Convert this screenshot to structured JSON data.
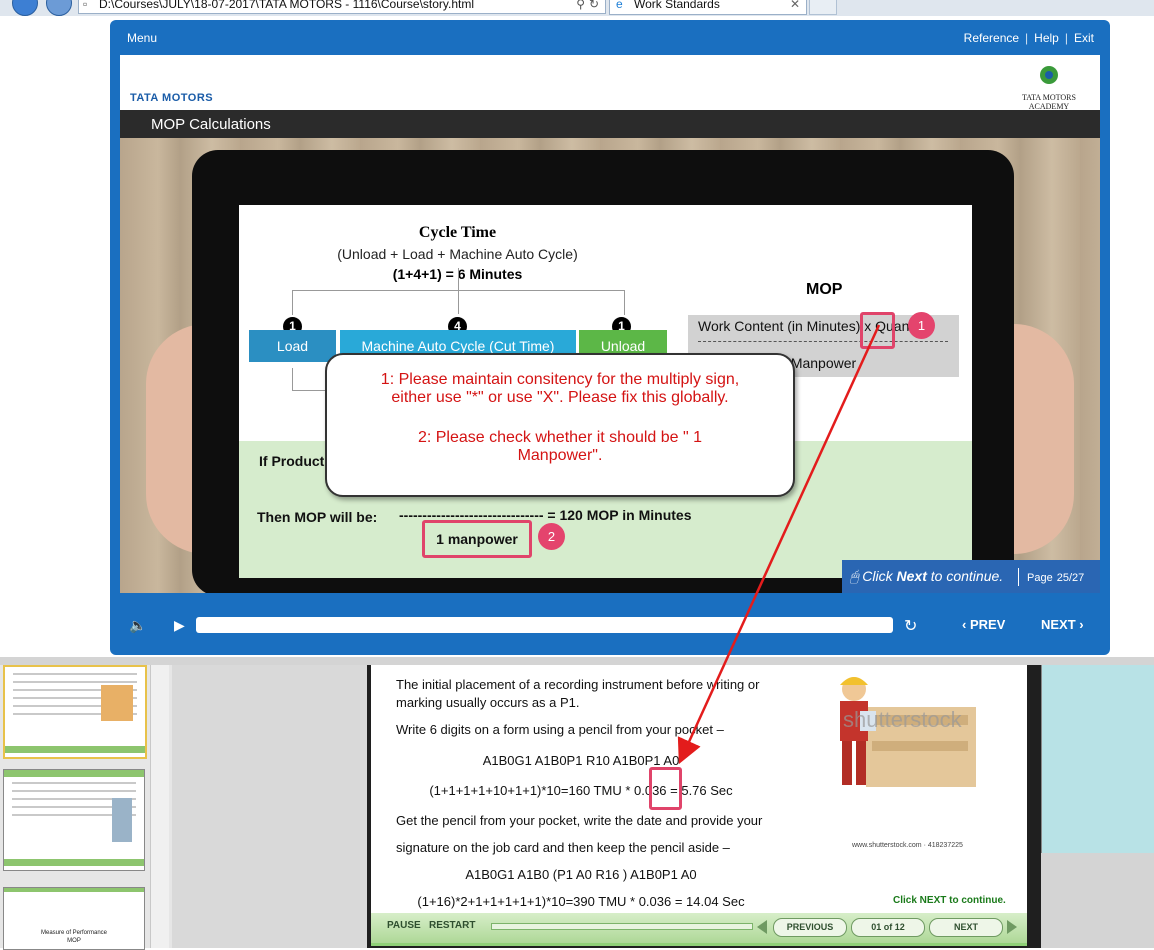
{
  "browser": {
    "address": "D:\\Courses\\JULY\\18-07-2017\\TATA MOTORS - 1116\\Course\\story.html",
    "tab_title": "Work Standards"
  },
  "player": {
    "menu_label": "Menu",
    "links": [
      "Reference",
      "Help",
      "Exit"
    ],
    "brand_left": "TATA MOTORS",
    "brand_right": "TATA MOTORS ACADEMY",
    "slide_title": "MOP Calculations",
    "click_next": {
      "prefix": "Click ",
      "bold": "Next",
      "suffix": " to continue."
    },
    "page_label": "Page",
    "page_value": "25/27",
    "prev_label": "PREV",
    "next_label": "NEXT"
  },
  "slide": {
    "cycle_title": "Cycle Time",
    "cycle_sub": "(Unload + Load + Machine Auto Cycle)",
    "cycle_calc": "(1+4+1) = 6 Minutes",
    "boxes": [
      {
        "label": "Load",
        "badge": "1"
      },
      {
        "label": "Machine Auto Cycle (Cut Time)",
        "badge": "4"
      },
      {
        "label": "Unload",
        "badge": "1"
      }
    ],
    "mop_title": "MOP",
    "mop_numerator": "Work Content (in Minutes) x Quantity",
    "mop_denominator": "Manpower",
    "if_text": "If Product",
    "then_text": "Then MOP will be:",
    "then_eq": "------------------------------- = 120 MOP in Minutes",
    "manpower_box": "1 manpower",
    "marker_1": "1",
    "marker_2": "2"
  },
  "callout": {
    "line1": "1: Please maintain consitency for the multiply sign,",
    "line2": "either use \"*\" or use \"X\". Please fix this globally.",
    "line3": "2: Please check whether it should be \" 1",
    "line4": "Manpower\"."
  },
  "lower_course": {
    "p1a": "The initial placement of a recording instrument before writing or",
    "p1b": "marking usually occurs as a P1.",
    "p2": "Write 6 digits on a form using a pencil from your pocket –",
    "code1": "A1B0G1  A1B0P1 R10 A1B0P1 A0",
    "calc1": "(1+1+1+1+10+1+1)*10=160  TMU * 0.036 = 5.76 Sec",
    "p3a": "Get the pencil from your pocket, write the date and provide your",
    "p3b": "signature on the job card and then keep the pencil aside –",
    "code2": "A1B0G1  A1B0  (P1  A0  R16 ) A1B0P1  A0",
    "calc2": "(1+16)*2+1+1+1+1+1)*10=390  TMU * 0.036 = 14.04 Sec",
    "watermark": "shutterstock",
    "watermark_caption": "www.shutterstock.com · 418237225",
    "click_next": "Click NEXT to continue.",
    "pause": "PAUSE",
    "restart": "RESTART",
    "previous": "PREVIOUS",
    "page": "01 of 12",
    "next": "NEXT"
  },
  "thumbnails": {
    "third_title_a": "Measure of Performance",
    "third_title_b": "MOP"
  },
  "colors": {
    "player_blue": "#1a6fc0",
    "load": "#2b8fc2",
    "machine": "#29a9d8",
    "unload": "#5cb747",
    "annotation_red": "#d41313",
    "marker_pink": "#e4446d"
  }
}
